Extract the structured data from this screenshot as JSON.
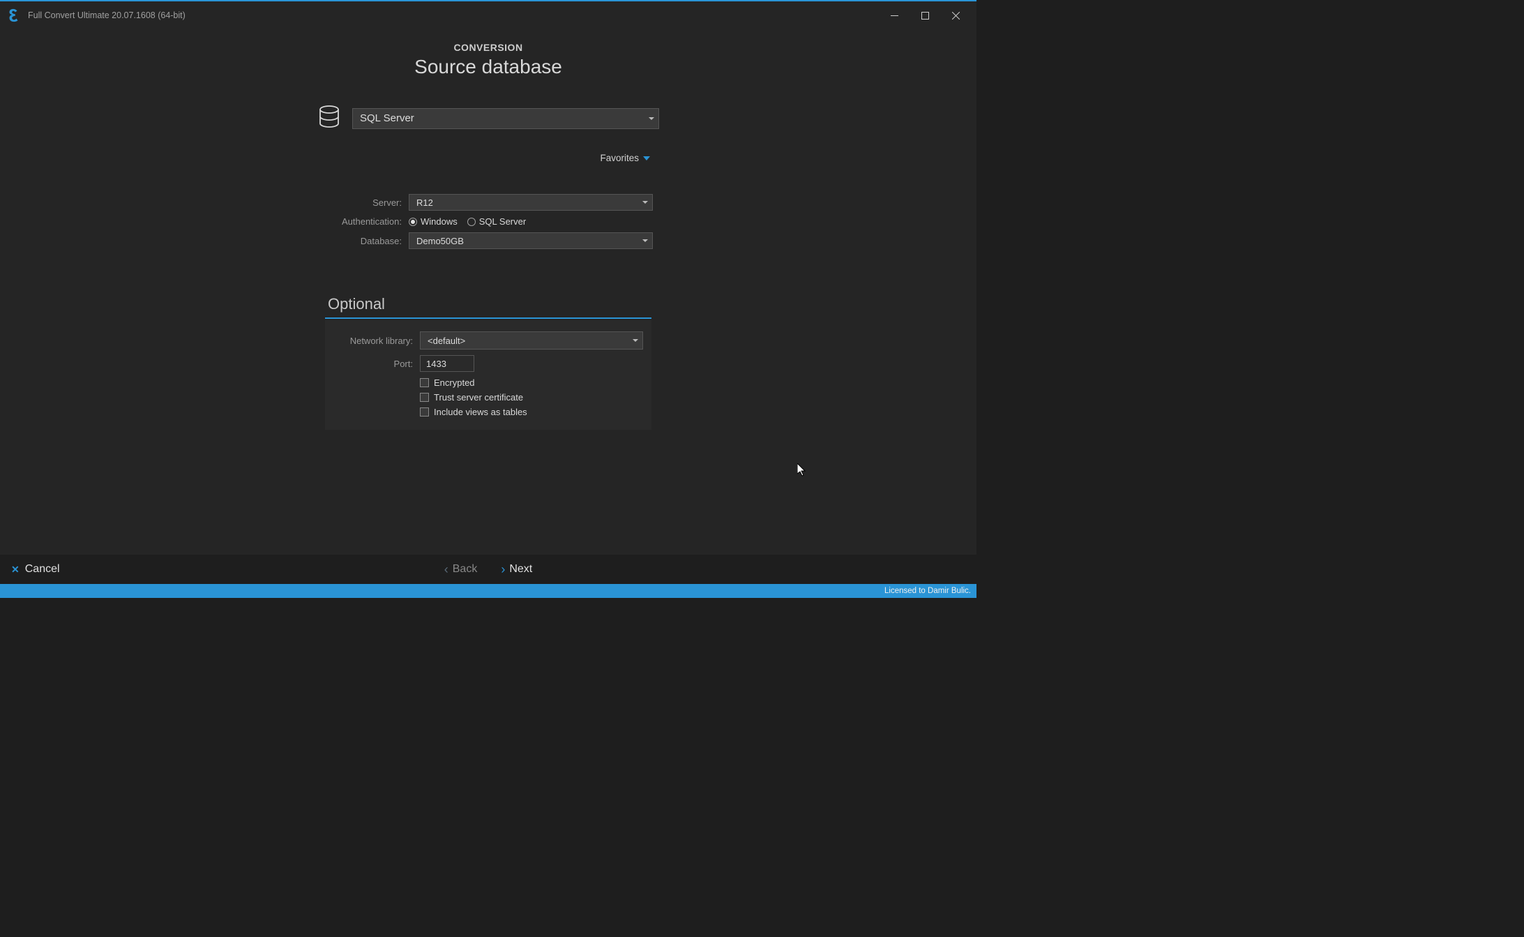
{
  "titlebar": {
    "title": "Full Convert Ultimate 20.07.1608 (64-bit)"
  },
  "header": {
    "step": "CONVERSION",
    "title": "Source database"
  },
  "dbSelect": {
    "value": "SQL Server"
  },
  "favorites": {
    "label": "Favorites"
  },
  "form": {
    "serverLabel": "Server:",
    "serverValue": "R12",
    "authLabel": "Authentication:",
    "authWindows": "Windows",
    "authSql": "SQL Server",
    "databaseLabel": "Database:",
    "databaseValue": "Demo50GB"
  },
  "optional": {
    "title": "Optional",
    "netLibLabel": "Network library:",
    "netLibValue": "<default>",
    "portLabel": "Port:",
    "portValue": "1433",
    "encrypted": "Encrypted",
    "trustCert": "Trust server certificate",
    "includeViews": "Include views as tables"
  },
  "footer": {
    "cancel": "Cancel",
    "back": "Back",
    "next": "Next"
  },
  "statusbar": {
    "license": "Licensed to Damir Bulic."
  }
}
